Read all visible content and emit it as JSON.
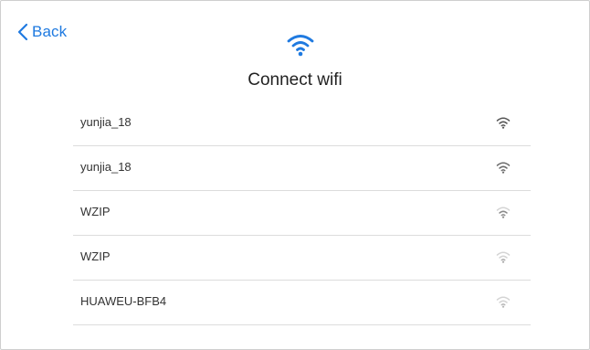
{
  "header": {
    "back_label": "Back",
    "title": "Connect wifi"
  },
  "colors": {
    "accent": "#1f7ae0",
    "text": "#333333",
    "divider": "#dcdcdc"
  },
  "networks": [
    {
      "ssid": "yunjia_18",
      "icon": "wifi-signal-icon",
      "signal_bars": 3,
      "signal_color": "#555555"
    },
    {
      "ssid": "yunjia_18",
      "icon": "wifi-signal-icon",
      "signal_bars": 3,
      "signal_color": "#6a6a6a"
    },
    {
      "ssid": "WZIP",
      "icon": "wifi-signal-icon",
      "signal_bars": 2,
      "signal_color": "#8a8a8a"
    },
    {
      "ssid": "WZIP",
      "icon": "wifi-signal-icon",
      "signal_bars": 1,
      "signal_color": "#a8a8a8"
    },
    {
      "ssid": "HUAWEU-BFB4",
      "icon": "wifi-signal-icon",
      "signal_bars": 1,
      "signal_color": "#b5b5b5"
    }
  ]
}
